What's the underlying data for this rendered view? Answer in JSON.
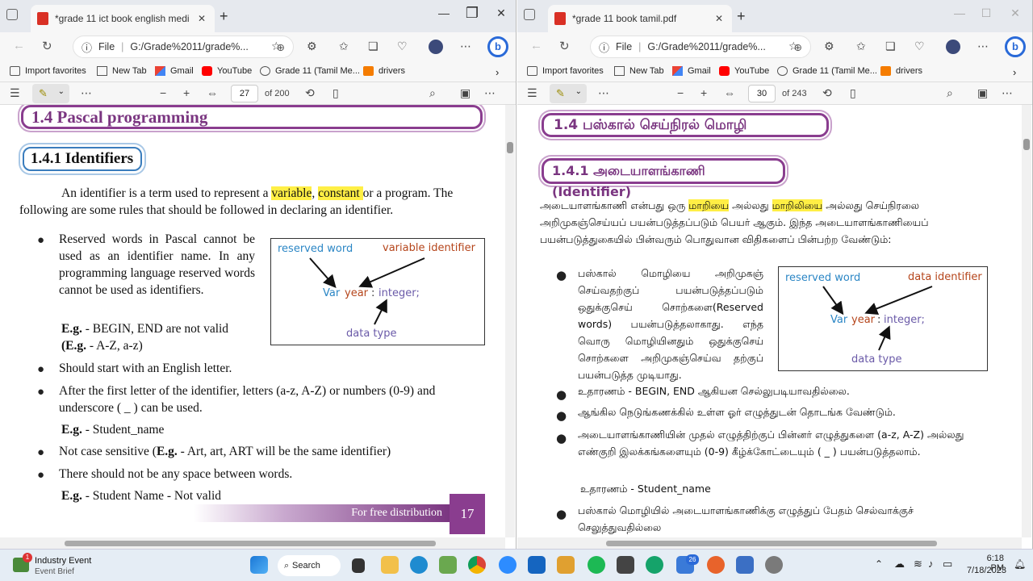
{
  "left": {
    "tab_title": "*grade 11 ict book english medi",
    "url": "G:/Grade%2011/grade%...",
    "file_label": "File",
    "favorites": [
      "Import favorites",
      "New Tab",
      "Gmail",
      "YouTube",
      "Grade 11 (Tamil Me...",
      "drivers"
    ],
    "page_current": "27",
    "page_total": "of 200",
    "heading": "1.4  Pascal programming",
    "subheading": "1.4.1 Identifiers",
    "intro_a": "An identifier is a term used to represent a ",
    "intro_hl1": "variable",
    "intro_b": ", ",
    "intro_hl2": "constant ",
    "intro_c": "or a program. The following are some rules that should be followed in declaring an identifier.",
    "bullet1": "Reserved words in Pascal cannot be used as an identifier name. In any programming language reserved words cannot be used as identifiers.",
    "eg1_label": "E.g.",
    "eg1_text": " - BEGIN, END are not valid",
    "eg2_open": "(",
    "eg2_label": "E.g.",
    "eg2_text": " - A-Z, a-z)",
    "bullet2": "Should start with an English letter.",
    "bullet3": "After the first letter of the identifier, letters (a-z, A-Z) or numbers (0-9) and underscore ( _ ) can be used.",
    "eg3_label": "E.g.",
    "eg3_text": " - Student_name",
    "bullet4_a": "Not case sensitive (",
    "bullet4_label": "E.g.",
    "bullet4_b": " - Art, art, ART will be the same identifier)",
    "bullet5": "There should not be any space between words.",
    "eg5_label": "E.g.",
    "eg5_text": " - Student Name - Not valid",
    "diagram": {
      "reserved": "reserved word",
      "variable": "variable identifier",
      "var": "Var",
      "year": "year",
      "colon": ":",
      "integer": "integer;",
      "datatype": "data type"
    },
    "footer": "For free distribution",
    "page_num": "17"
  },
  "right": {
    "tab_title": "*grade 11 book tamil.pdf",
    "url": "G:/Grade%2011/grade%...",
    "file_label": "File",
    "favorites": [
      "Import favorites",
      "New Tab",
      "Gmail",
      "YouTube",
      "Grade 11 (Tamil Me...",
      "drivers"
    ],
    "page_current": "30",
    "page_total": "of 243",
    "heading": "1.4 பஸ்கால் செய்நிரல் மொழி",
    "subheading": "1.4.1  அடையாளங்காணி (Identifier)",
    "intro_a": "அடையாளங்காணி என்பது ஒரு ",
    "intro_hl1": "மாறியை",
    "intro_b": " அல்லது ",
    "intro_hl2": "மாறிலியை",
    "intro_c": " அல்லது செய்நிரலை அறிமுகஞ்செய்யப் பயன்படுத்தப்படும் பெயர் ஆகும். இந்த அடையாளங்காணியைப் பயன்படுத்துகையில் பின்வரும்  பொதுவான விதிகளைப் பின்பற்ற வேண்டும்:",
    "bullet1": "பஸ்கால் மொழியை அறிமுகஞ் செய்வதற்குப் பயன்படுத்தப்படும் ஒதுக்குசெய் சொற்களை(Reserved words) பயன்படுத்தலாகாது. எந்த வொரு மொழியினதும் ஒதுக்குசெய் சொற்களை அறிமுகஞ்செய்வ தற்குப் பயன்படுத்த முடியாது.",
    "bullet2": "உதாரணம்  -  BEGIN, END ஆகியன செல்லுபடியாவதில்லை.",
    "bullet3": "ஆங்கில நெடுங்கணக்கில் உள்ள ஓர் எழுத்துடன் தொடங்க வேண்டும்.",
    "bullet4": "அடையாளங்காணியின் முதல் எழுத்திற்குப் பின்னர் எழுத்துகளை (a-z, A-Z) அல்லது எண்குறி இலக்கங்களையும் (0-9) கீழ்க்கோட்டையும் ( _ ) பயன்படுத்தலாம்.",
    "eg4": "உதாரணம்  -  Student_name",
    "bullet5": "பஸ்கால் மொழியில் அடையாளங்காணிக்கு எழுத்துப் பேதம் செல்வாக்குச் செலுத்துவதில்லை",
    "diagram": {
      "reserved": "reserved word",
      "variable": "data identifier",
      "var": "Var",
      "year": "year",
      "colon": ":",
      "integer": "integer;",
      "datatype": "data type"
    }
  },
  "taskbar": {
    "notification_title": "Industry Event",
    "notification_sub": "Event Brief",
    "notification_badge": "1",
    "search_label": "Search",
    "badge_26": "26",
    "time": "6:18 PM",
    "date": "7/18/2023"
  }
}
